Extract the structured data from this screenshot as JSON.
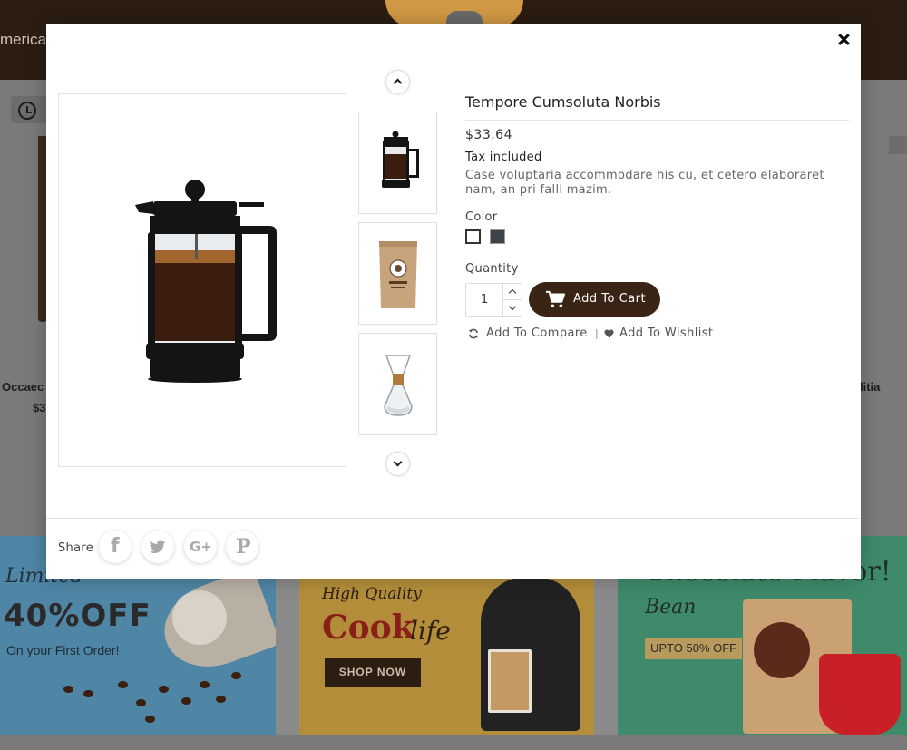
{
  "background": {
    "header_partial_text": "merica",
    "left_product": {
      "name_partial": "Occaec",
      "price_partial": "$3"
    },
    "right_product": {
      "name_partial": "litia"
    },
    "banner_1": {
      "script_partial": "Limited",
      "headline": "40%OFF",
      "subline": "On your First Order!"
    },
    "banner_2": {
      "script": "High Quality",
      "cook": "Cook",
      "life": "life",
      "button": "SHOP NOW"
    },
    "banner_3": {
      "headline_partial": "Chocolate Flavor!",
      "script": "Bean",
      "badge": "UPTO 50% OFF"
    }
  },
  "modal": {
    "close_icon": "close-icon",
    "product": {
      "title": "Tempore Cumsoluta Norbis",
      "price": "$33.64",
      "tax_note": "Tax included",
      "description": "Case voluptaria accommodare his cu, et cetero elaboraret nam, an pri falli mazim.",
      "color_label": "Color",
      "colors": [
        {
          "name": "white",
          "hex": "#ffffff"
        },
        {
          "name": "dark grey",
          "hex": "#3d4349"
        }
      ],
      "quantity_label": "Quantity",
      "quantity_value": "1",
      "add_to_cart": "Add To Cart",
      "add_to_compare": "Add To Compare",
      "link_separator": "|",
      "add_to_wishlist": "Add To Wishlist"
    },
    "thumbnails": [
      {
        "name": "french-press"
      },
      {
        "name": "coffee-bag"
      },
      {
        "name": "chemex-pour-over"
      }
    ],
    "share": {
      "label": "Share",
      "networks": [
        "facebook",
        "twitter",
        "google-plus",
        "pinterest"
      ]
    }
  },
  "colors": {
    "accent_brown": "#3a2415",
    "header_brown": "#2b1d12"
  }
}
